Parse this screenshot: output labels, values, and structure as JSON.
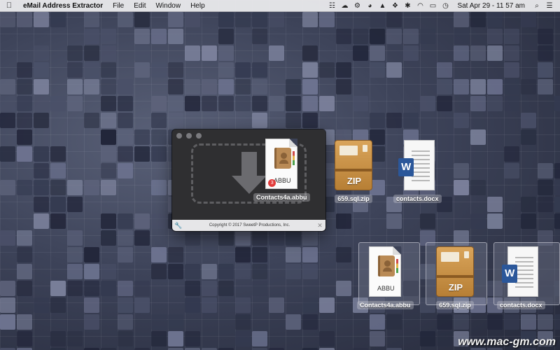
{
  "menubar": {
    "app_name": "eMail Address Extractor",
    "menus": [
      "File",
      "Edit",
      "Window",
      "Help"
    ],
    "clock": "Sat Apr 29 - 11 57 am",
    "status_icons": [
      "wireless-icon",
      "cloud-icon",
      "gear-icon",
      "mask-icon",
      "shield-icon",
      "dropbox-icon",
      "bluetooth-icon",
      "wifi-icon",
      "airplay-icon",
      "time-machine-icon",
      "search-icon",
      "list-icon"
    ]
  },
  "app_window": {
    "copyright": "Copyright © 2017 SweetP Productions, Inc."
  },
  "desktop": {
    "dragged": [
      {
        "label": "Contacts4a.abbu",
        "type": "abbu",
        "badge": "3",
        "icon_text": "ABBU"
      },
      {
        "label": "659.sql.zip",
        "type": "zip",
        "icon_text": "ZIP"
      },
      {
        "label": "contacts.docx",
        "type": "docx",
        "icon_text": "W"
      }
    ],
    "selected": [
      {
        "label": "Contacts4a.abbu",
        "type": "abbu",
        "icon_text": "ABBU"
      },
      {
        "label": "659.sql.zip",
        "type": "zip",
        "icon_text": "ZIP"
      },
      {
        "label": "contacts.docx",
        "type": "docx",
        "icon_text": "W"
      }
    ]
  },
  "watermark": "www.mac-gm.com"
}
